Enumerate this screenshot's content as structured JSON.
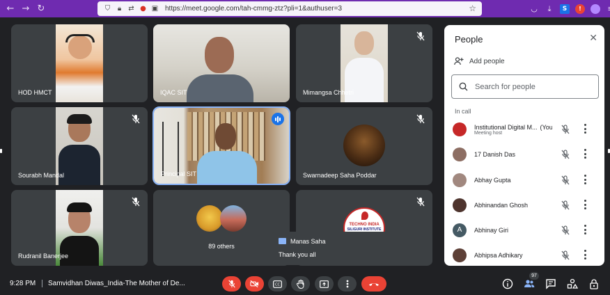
{
  "browser": {
    "url": "https://meet.google.com/tah-cmmg-ztz?pli=1&authuser=3"
  },
  "tiles": [
    {
      "name": "HOD HMCT",
      "muted": false
    },
    {
      "name": "IQAC SIT",
      "muted": false
    },
    {
      "name": "Mimangsa Chhetri",
      "muted": true
    },
    {
      "name": "Sourabh Mandal",
      "muted": true
    },
    {
      "name": "Principal SIT",
      "muted": false,
      "speaking": true
    },
    {
      "name": "Swarnadeep Saha Poddar",
      "muted": true
    },
    {
      "name": "Rudranil Banerjee",
      "muted": true
    },
    {
      "name": "89 others",
      "muted": false
    },
    {
      "name": "",
      "muted": true,
      "logo_text_1": "TECHNO INDIA",
      "logo_text_2": "SILIGURI INSTITUTE"
    }
  ],
  "panel": {
    "title": "People",
    "add_people": "Add people",
    "search_placeholder": "Search for people",
    "section": "In call",
    "people": [
      {
        "name": "Institutional Digital M...",
        "tag": "(You)",
        "sub": "Meeting host",
        "avatar": "#c62828"
      },
      {
        "name": "17 Danish Das",
        "tag": "",
        "sub": "",
        "avatar": "#8d6e63"
      },
      {
        "name": "Abhay Gupta",
        "tag": "",
        "sub": "",
        "avatar": "#a1887f"
      },
      {
        "name": "Abhinandan Ghosh",
        "tag": "",
        "sub": "",
        "avatar": "#4e342e"
      },
      {
        "name": "Abhinay Giri",
        "tag": "",
        "sub": "",
        "avatar": "#455a64",
        "initial": "A"
      },
      {
        "name": "Abhipsa Adhikary",
        "tag": "",
        "sub": "",
        "avatar": "#5d4037"
      }
    ]
  },
  "toast": {
    "sender": "Manas Saha",
    "message": "Thank you all"
  },
  "bottom": {
    "time": "9:28 PM",
    "meeting_title": "Samvidhan Diwas_India-The Mother of De...",
    "participant_count": "97"
  },
  "colors": {
    "browser_bar": "#6f2bb0",
    "background": "#202124",
    "tile": "#3c4043",
    "red": "#ea4335",
    "accent": "#1a73e8"
  }
}
